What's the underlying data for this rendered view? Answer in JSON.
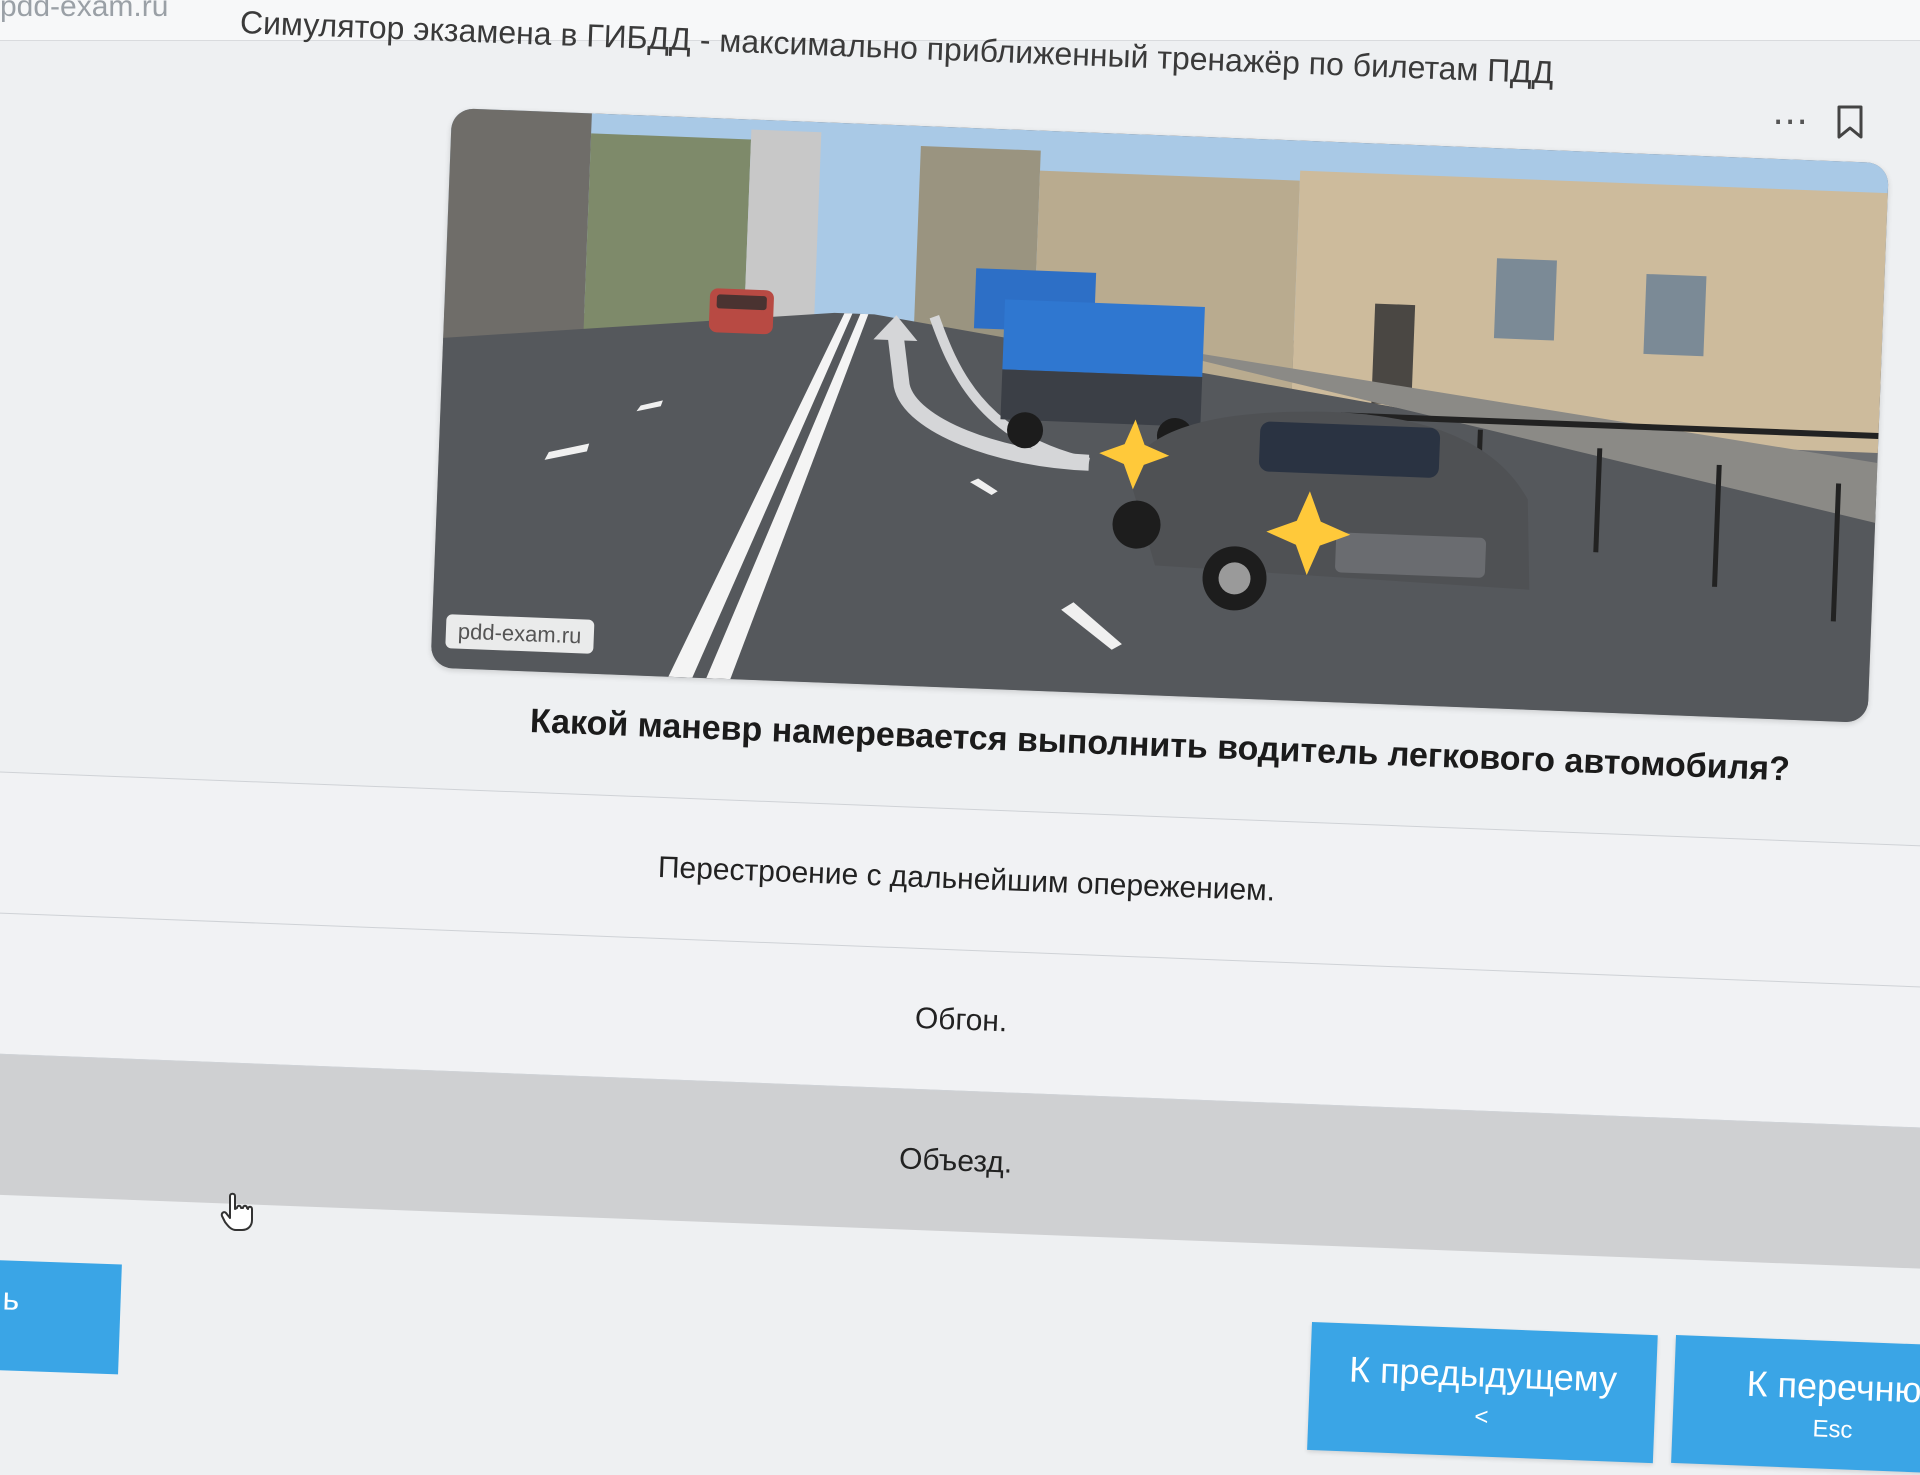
{
  "header": {
    "site_url": "pdd-exam.ru",
    "title": "Симулятор экзамена в ГИБДД - максимально приближенный тренажёр по билетам ПДД",
    "more_icon": "more-dots-icon",
    "bookmark_icon": "bookmark-icon"
  },
  "picture": {
    "watermark": "pdd-exam.ru",
    "description_icon": "road-scene-illustration"
  },
  "question": {
    "text": "Какой маневр намеревается выполнить водитель легкового автомобиля?"
  },
  "answers": [
    {
      "text": "Перестроение с дальнейшим опережением."
    },
    {
      "text": "Обгон."
    },
    {
      "text": "Объезд."
    }
  ],
  "buttons": {
    "left_partial": "ь",
    "previous": {
      "label": "К предыдущему",
      "key": "<"
    },
    "list": {
      "label": "К перечню",
      "key": "Esc"
    }
  },
  "colors": {
    "button_blue": "#3aa5e6",
    "hover_row": "#cfd0d2"
  }
}
